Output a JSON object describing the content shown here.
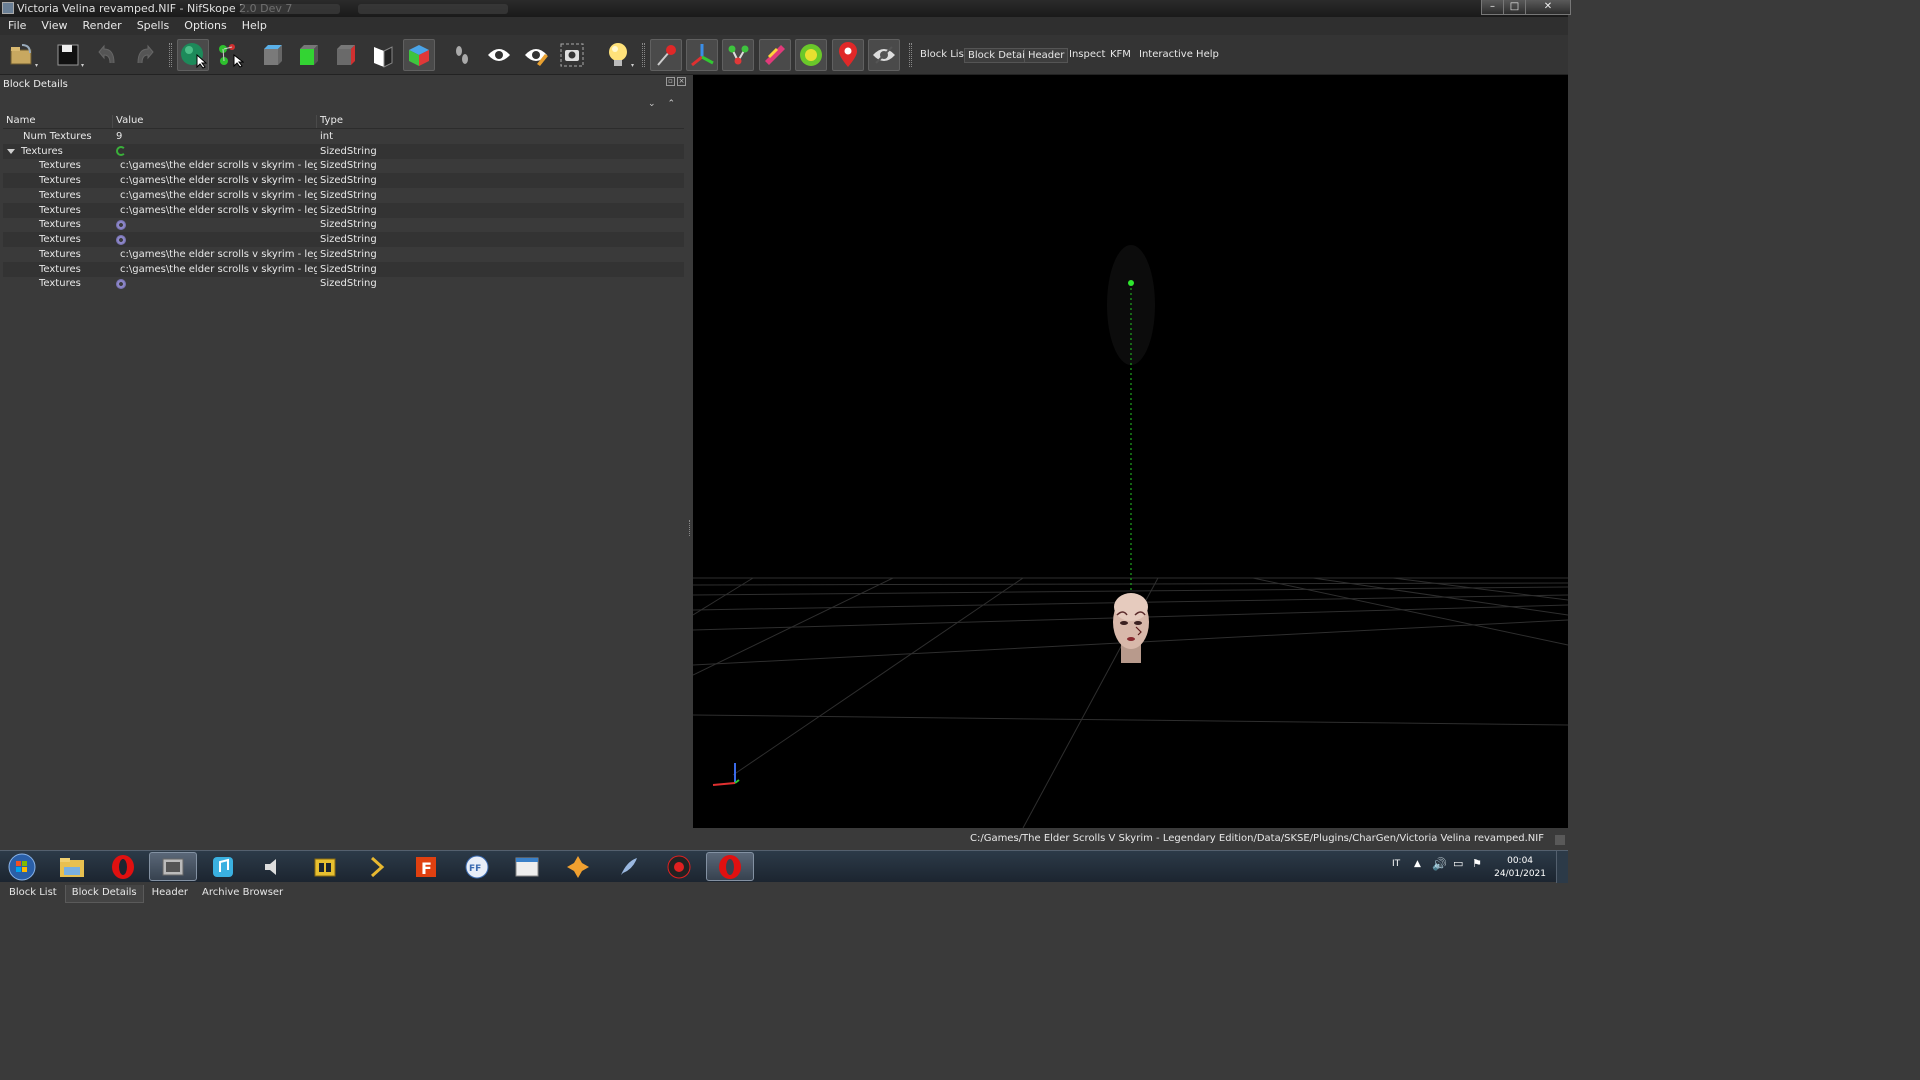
{
  "window": {
    "title": "Victoria Velina revamped.NIF - NifSkope 2.0 Dev 7",
    "controls": {
      "minimize": "–",
      "maximize": "□",
      "close": "✕"
    }
  },
  "menu": [
    "File",
    "View",
    "Render",
    "Spells",
    "Options",
    "Help"
  ],
  "toolbar": {
    "icons": [
      "load-icon",
      "save-icon",
      "undo-icon",
      "redo-icon",
      "select-object-icon",
      "select-vertex-icon",
      "view-top-icon",
      "view-front-icon",
      "view-side-icon",
      "view-flip-icon",
      "view-user-icon",
      "walk-icon",
      "show-hidden-icon",
      "show-marker-icon",
      "screenshot-icon",
      "lighting-icon",
      "show-nodes-icon",
      "show-axes-icon",
      "show-connections-icon",
      "show-constraints-icon",
      "show-collision-icon",
      "show-markers-icon",
      "hide-icon"
    ],
    "links": [
      "Block List",
      "Block Details",
      "Header",
      "Inspect",
      "KFM",
      "Interactive Help"
    ],
    "active_link": "Block Details"
  },
  "block_details": {
    "title": "Block Details",
    "columns": [
      "Name",
      "Value",
      "Type"
    ],
    "rows": [
      {
        "name": "Num Textures",
        "value": "9",
        "type": "int",
        "icon": "",
        "indent": 1
      },
      {
        "name": "Textures",
        "value": "",
        "type": "SizedString",
        "icon": "ref",
        "indent": 0,
        "expanded": true
      },
      {
        "name": "Textures",
        "value": "c:\\games\\the elder scrolls v skyrim - lege...",
        "type": "SizedString",
        "icon": "gear",
        "indent": 2
      },
      {
        "name": "Textures",
        "value": "c:\\games\\the elder scrolls v skyrim - lege...",
        "type": "SizedString",
        "icon": "gear",
        "indent": 2
      },
      {
        "name": "Textures",
        "value": "c:\\games\\the elder scrolls v skyrim - lege...",
        "type": "SizedString",
        "icon": "gear",
        "indent": 2
      },
      {
        "name": "Textures",
        "value": "c:\\games\\the elder scrolls v skyrim - lege...",
        "type": "SizedString",
        "icon": "gear",
        "indent": 2
      },
      {
        "name": "Textures",
        "value": "",
        "type": "SizedString",
        "icon": "gear",
        "indent": 2
      },
      {
        "name": "Textures",
        "value": "",
        "type": "SizedString",
        "icon": "gear",
        "indent": 2
      },
      {
        "name": "Textures",
        "value": "c:\\games\\the elder scrolls v skyrim - lege...",
        "type": "SizedString",
        "icon": "gear",
        "indent": 2
      },
      {
        "name": "Textures",
        "value": "c:\\games\\the elder scrolls v skyrim - lege...",
        "type": "SizedString",
        "icon": "gear",
        "indent": 2
      },
      {
        "name": "Textures",
        "value": "",
        "type": "SizedString",
        "icon": "gear",
        "indent": 2
      }
    ]
  },
  "bottom_tabs": [
    "Block List",
    "Block Details",
    "Header",
    "Archive Browser"
  ],
  "active_bottom_tab": "Block Details",
  "status": {
    "path": "C:/Games/The Elder Scrolls V Skyrim - Legendary Edition/Data/SKSE/Plugins/CharGen/Victoria Velina revamped.NIF"
  },
  "taskbar": {
    "apps": [
      "start-orb",
      "file-explorer",
      "opera",
      "video-app",
      "music-app",
      "speaker-app",
      "folder-app",
      "pointer-app",
      "foxit-app",
      "ffdec-app",
      "window-app",
      "puzzle-app",
      "feather-app",
      "spider-app",
      "opera-active"
    ],
    "language": "IT",
    "time": "00:04",
    "date": "24/01/2021"
  },
  "colors": {
    "accent_green": "#2ecc2e",
    "panel_bg": "#3a3a3a",
    "viewport_bg": "#000000"
  }
}
